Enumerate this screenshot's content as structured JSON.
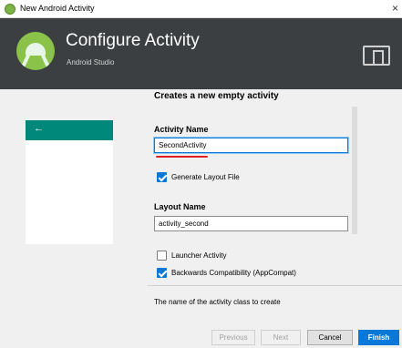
{
  "window": {
    "title": "New Android Activity",
    "close": "×"
  },
  "header": {
    "title": "Configure Activity",
    "subtitle": "Android Studio"
  },
  "preview": {
    "back_arrow": "←"
  },
  "form": {
    "title": "Creates a new empty activity",
    "activity_name_label": "Activity Name",
    "activity_name_value": "SecondActivity",
    "generate_layout_label": "Generate Layout File",
    "generate_layout_checked": true,
    "layout_name_label": "Layout Name",
    "layout_name_value": "activity_second",
    "launcher_label": "Launcher Activity",
    "launcher_checked": false,
    "backwards_label": "Backwards Compatibility (AppCompat)",
    "backwards_checked": true
  },
  "help_text": "The name of the activity class to create",
  "buttons": {
    "previous": "Previous",
    "next": "Next",
    "cancel": "Cancel",
    "finish": "Finish"
  },
  "colors": {
    "header_bg": "#3c3f41",
    "accent": "#0a78d7",
    "teal_bar": "#00897b",
    "underline": "#e02020"
  }
}
